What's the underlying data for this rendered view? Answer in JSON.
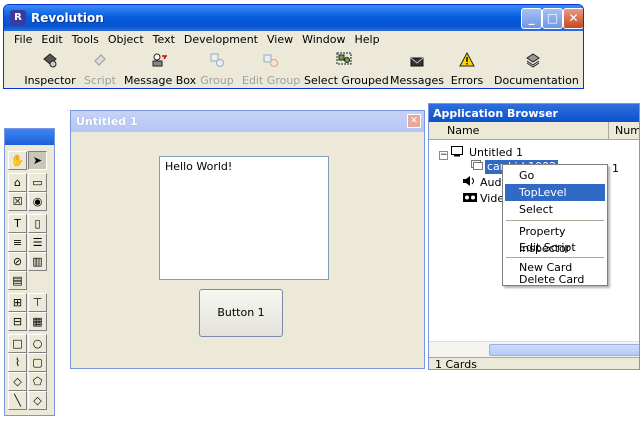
{
  "app": {
    "title": "Revolution",
    "menu": [
      "File",
      "Edit",
      "Tools",
      "Object",
      "Text",
      "Development",
      "View",
      "Window",
      "Help"
    ],
    "toolbar": [
      {
        "label": "Inspector",
        "icon": "inspector-icon",
        "enabled": true
      },
      {
        "label": "Script",
        "icon": "script-icon",
        "enabled": false
      },
      {
        "label": "Message Box",
        "icon": "message-box-icon",
        "enabled": true
      },
      {
        "label": "Group",
        "icon": "group-icon",
        "enabled": false
      },
      {
        "label": "Edit Group",
        "icon": "edit-group-icon",
        "enabled": false
      },
      {
        "label": "Select Grouped",
        "icon": "select-grouped-icon",
        "enabled": true
      },
      {
        "label": "Messages",
        "icon": "messages-icon",
        "enabled": true
      },
      {
        "label": "Errors",
        "icon": "errors-icon",
        "enabled": true
      },
      {
        "label": "Documentation",
        "icon": "documentation-icon",
        "enabled": true
      }
    ]
  },
  "stack": {
    "title": "Untitled 1",
    "field_text": "Hello World!",
    "button_label": "Button 1"
  },
  "app_browser": {
    "title": "Application Browser",
    "columns": [
      "Name",
      "Num"
    ],
    "tree": {
      "stack_name": "Untitled 1",
      "card_name": "card id 1002",
      "card_num": "1",
      "audio_label": "Audio",
      "video_label": "Video"
    },
    "status": "1 Cards"
  },
  "context_menu": {
    "items": [
      "Go",
      "TopLevel",
      "Select",
      "Property Inspector",
      "Edit Script",
      "New Card",
      "Delete Card"
    ],
    "highlighted": "TopLevel"
  },
  "colors": {
    "xp_title_blue": "#0a5de0",
    "highlight": "#316ac5",
    "window_face": "#ece9d8"
  }
}
